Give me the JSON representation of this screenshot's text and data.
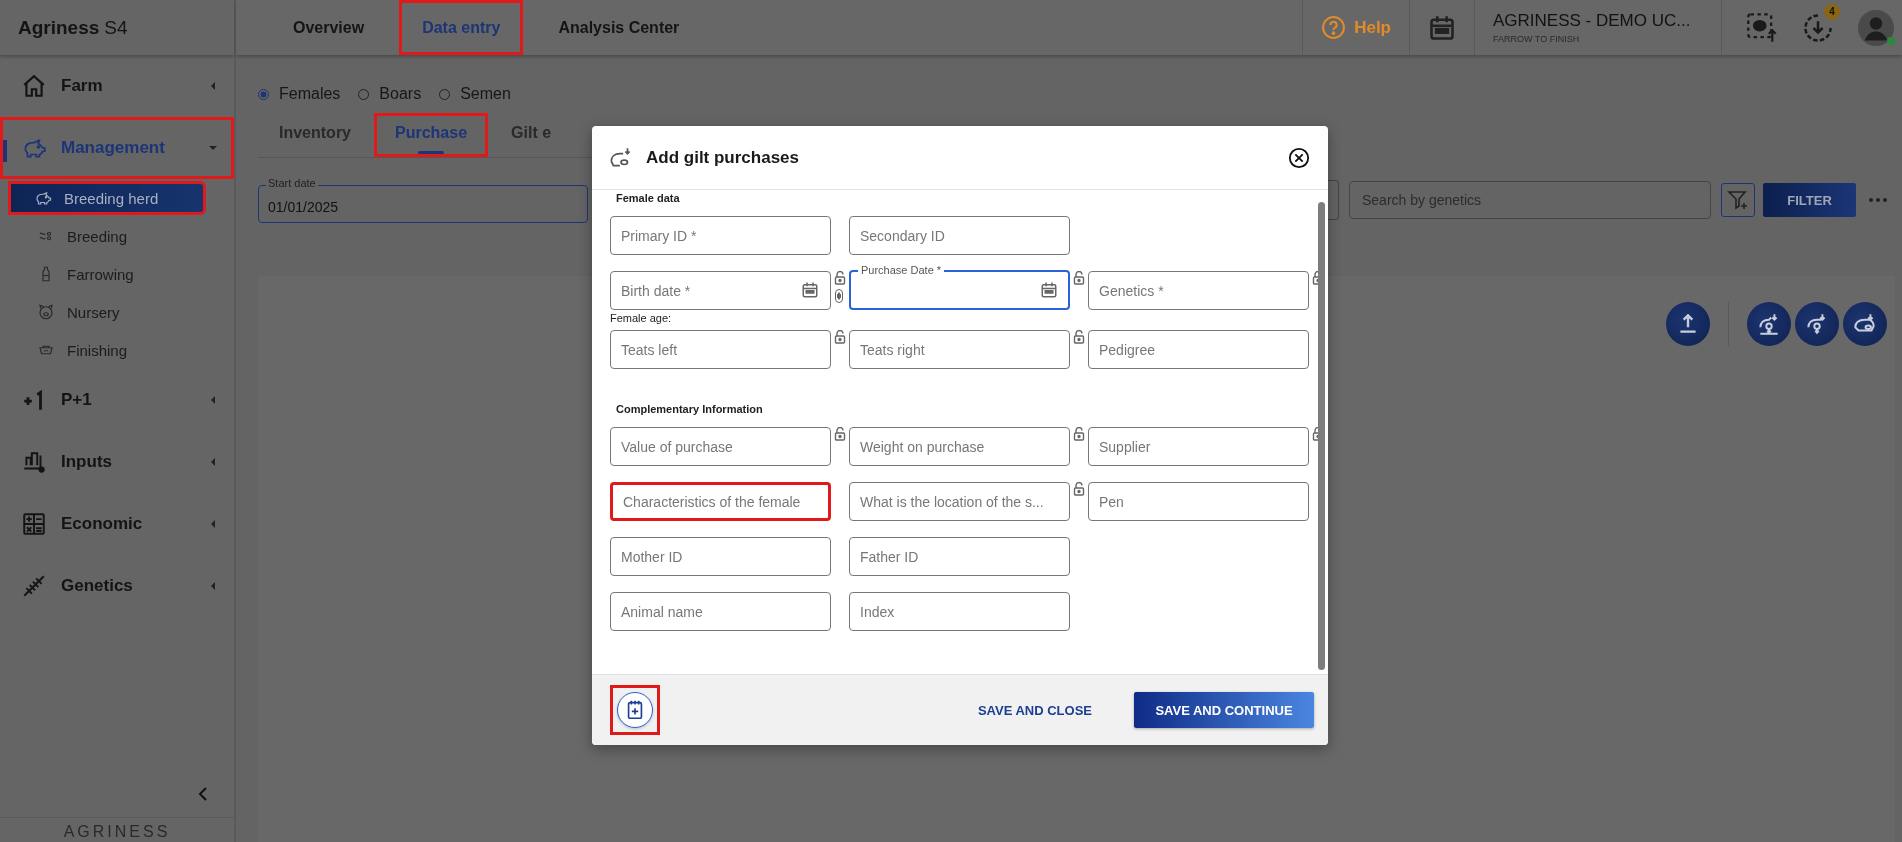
{
  "brand": {
    "name": "Agriness",
    "suffix": "S4"
  },
  "sidebar": {
    "items": [
      {
        "label": "Farm",
        "selected": false,
        "expanded": false,
        "highlighted": false
      },
      {
        "label": "Management",
        "selected": true,
        "expanded": true,
        "highlighted": true,
        "children": [
          {
            "label": "Breeding herd",
            "selected": true,
            "highlighted": true
          },
          {
            "label": "Breeding",
            "selected": false,
            "highlighted": false
          },
          {
            "label": "Farrowing",
            "selected": false,
            "highlighted": false
          },
          {
            "label": "Nursery",
            "selected": false,
            "highlighted": false
          },
          {
            "label": "Finishing",
            "selected": false,
            "highlighted": false
          }
        ]
      },
      {
        "label": "P+1",
        "selected": false,
        "expanded": false,
        "highlighted": false
      },
      {
        "label": "Inputs",
        "selected": false,
        "expanded": false,
        "highlighted": false
      },
      {
        "label": "Economic",
        "selected": false,
        "expanded": false,
        "highlighted": false
      },
      {
        "label": "Genetics",
        "selected": false,
        "expanded": false,
        "highlighted": false
      }
    ],
    "footer_logo": "AGRINESS"
  },
  "nav_tabs": [
    {
      "label": "Overview",
      "selected": false,
      "highlighted": false
    },
    {
      "label": "Data entry",
      "selected": true,
      "highlighted": true
    },
    {
      "label": "Analysis Center",
      "selected": false,
      "highlighted": false
    }
  ],
  "header": {
    "help": "Help",
    "farm_name": "AGRINESS - DEMO UC...",
    "farm_type": "FARROW TO FINISH",
    "download_badge": "4",
    "online": true
  },
  "animal_types": [
    {
      "label": "Females",
      "selected": true
    },
    {
      "label": "Boars",
      "selected": false
    },
    {
      "label": "Semen",
      "selected": false
    }
  ],
  "sub_tabs": [
    {
      "label": "Inventory",
      "selected": false,
      "highlighted": false
    },
    {
      "label": "Purchase",
      "selected": true,
      "highlighted": true
    },
    {
      "label": "Gilt e",
      "selected": false,
      "highlighted": false
    }
  ],
  "filters": {
    "start_date": {
      "label": "Start date",
      "value": "01/01/2025"
    },
    "genetics_search": {
      "placeholder": "Search by genetics"
    },
    "filter_button": "FILTER"
  },
  "modal": {
    "title": "Add gilt purchases",
    "sections": [
      {
        "title": "Female data",
        "rows": [
          {
            "fields": [
              {
                "placeholder": "Primary ID *",
                "kind": "text",
                "focused": false,
                "highlighted": false
              },
              {
                "placeholder": "Secondary ID",
                "kind": "text",
                "focused": false,
                "highlighted": false
              }
            ]
          },
          {
            "fields": [
              {
                "placeholder": "Birth date *",
                "kind": "date",
                "focused": false,
                "highlighted": false,
                "locked": false,
                "toggle": true
              },
              {
                "label": "Purchase Date *",
                "kind": "date",
                "focused": true,
                "highlighted": false,
                "locked": false
              },
              {
                "placeholder": "Genetics *",
                "kind": "text",
                "focused": false,
                "highlighted": false,
                "locked": false
              }
            ],
            "note": "Female age:"
          },
          {
            "fields": [
              {
                "placeholder": "Teats left",
                "kind": "text",
                "focused": false,
                "highlighted": false,
                "locked": false
              },
              {
                "placeholder": "Teats right",
                "kind": "text",
                "focused": false,
                "highlighted": false,
                "locked": false
              },
              {
                "placeholder": "Pedigree",
                "kind": "text",
                "focused": false,
                "highlighted": false
              }
            ]
          }
        ]
      },
      {
        "title": "Complementary Information",
        "rows": [
          {
            "fields": [
              {
                "placeholder": "Value of purchase",
                "kind": "text",
                "focused": false,
                "highlighted": false,
                "locked": false
              },
              {
                "placeholder": "Weight on purchase",
                "kind": "text",
                "focused": false,
                "highlighted": false,
                "locked": false
              },
              {
                "placeholder": "Supplier",
                "kind": "text",
                "focused": false,
                "highlighted": false,
                "locked": false
              }
            ]
          },
          {
            "fields": [
              {
                "placeholder": "Characteristics of the female",
                "kind": "text",
                "focused": false,
                "highlighted": true
              },
              {
                "placeholder": "What is the location of the s...",
                "kind": "text",
                "focused": false,
                "highlighted": false,
                "locked": false
              },
              {
                "placeholder": "Pen",
                "kind": "text",
                "focused": false,
                "highlighted": false
              }
            ]
          },
          {
            "fields": [
              {
                "placeholder": "Mother ID",
                "kind": "text",
                "focused": false,
                "highlighted": false
              },
              {
                "placeholder": "Father ID",
                "kind": "text",
                "focused": false,
                "highlighted": false
              }
            ]
          },
          {
            "fields": [
              {
                "placeholder": "Animal name",
                "kind": "text",
                "focused": false,
                "highlighted": false
              },
              {
                "placeholder": "Index",
                "kind": "text",
                "focused": false,
                "highlighted": false
              }
            ]
          }
        ]
      }
    ],
    "notes_button_highlighted": true,
    "save_close": "SAVE AND CLOSE",
    "save_continue": "SAVE AND CONTINUE"
  }
}
